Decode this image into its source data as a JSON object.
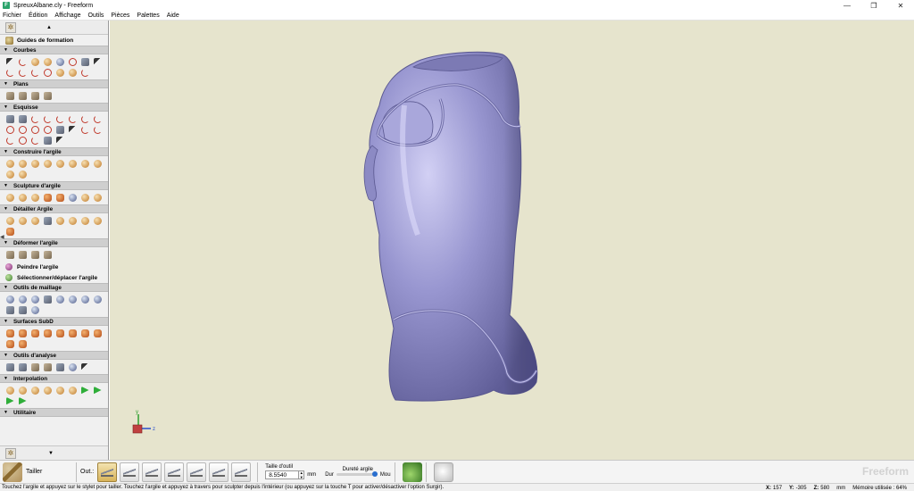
{
  "window": {
    "title": "SpreuxAlbane.cly - Freeform",
    "controls": [
      "—",
      "❐",
      "✕"
    ]
  },
  "menu": [
    "Fichier",
    "Édition",
    "Affichage",
    "Outils",
    "Pièces",
    "Palettes",
    "Aide"
  ],
  "palette": {
    "guides_label": "Guides de formation",
    "sections": [
      {
        "title": "Courbes"
      },
      {
        "title": "Plans"
      },
      {
        "title": "Esquisse"
      },
      {
        "title": "Construire l'argile"
      },
      {
        "title": "Sculpture d'argile"
      },
      {
        "title": "Détailler Argile"
      },
      {
        "title": "Déformer l'argile"
      },
      {
        "title": "Outils de maillage"
      },
      {
        "title": "Surfaces SubD"
      },
      {
        "title": "Outils d'analyse"
      },
      {
        "title": "Interpolation"
      },
      {
        "title": "Utilitaire"
      }
    ],
    "text_tools": [
      "Peindre l'argile",
      "Sélectionner/déplacer l'argile"
    ]
  },
  "viewport": {
    "background": "#e6e4cd",
    "model_color": "#8f8dc6",
    "axis_labels": {
      "y": "y",
      "z": "z"
    }
  },
  "toolbar": {
    "tool_name": "Tailler",
    "outil_label": "Out.:",
    "size_label": "Taille d'outil",
    "size_value": "8.5540",
    "size_unit": "mm",
    "hardness_label": "Dureté argile",
    "hard_label": "Dur",
    "soft_label": "Mou",
    "hardness_level": 1.0,
    "brand": "Freeform"
  },
  "status": {
    "message": "Touchez l'argile et appuyez sur le stylet pour tailler. Touchez l'argile et appuyez à travers pour sculpter depuis l'intérieur (ou appuyez sur la touche T pour activer/désactiver l'option Surgir).",
    "x_label": "X:",
    "x_value": "157",
    "y_label": "Y:",
    "y_value": "-305",
    "z_label": "Z:",
    "z_value": "580",
    "unit": "mm",
    "memory": "Mémoire utilisée : 64%"
  }
}
